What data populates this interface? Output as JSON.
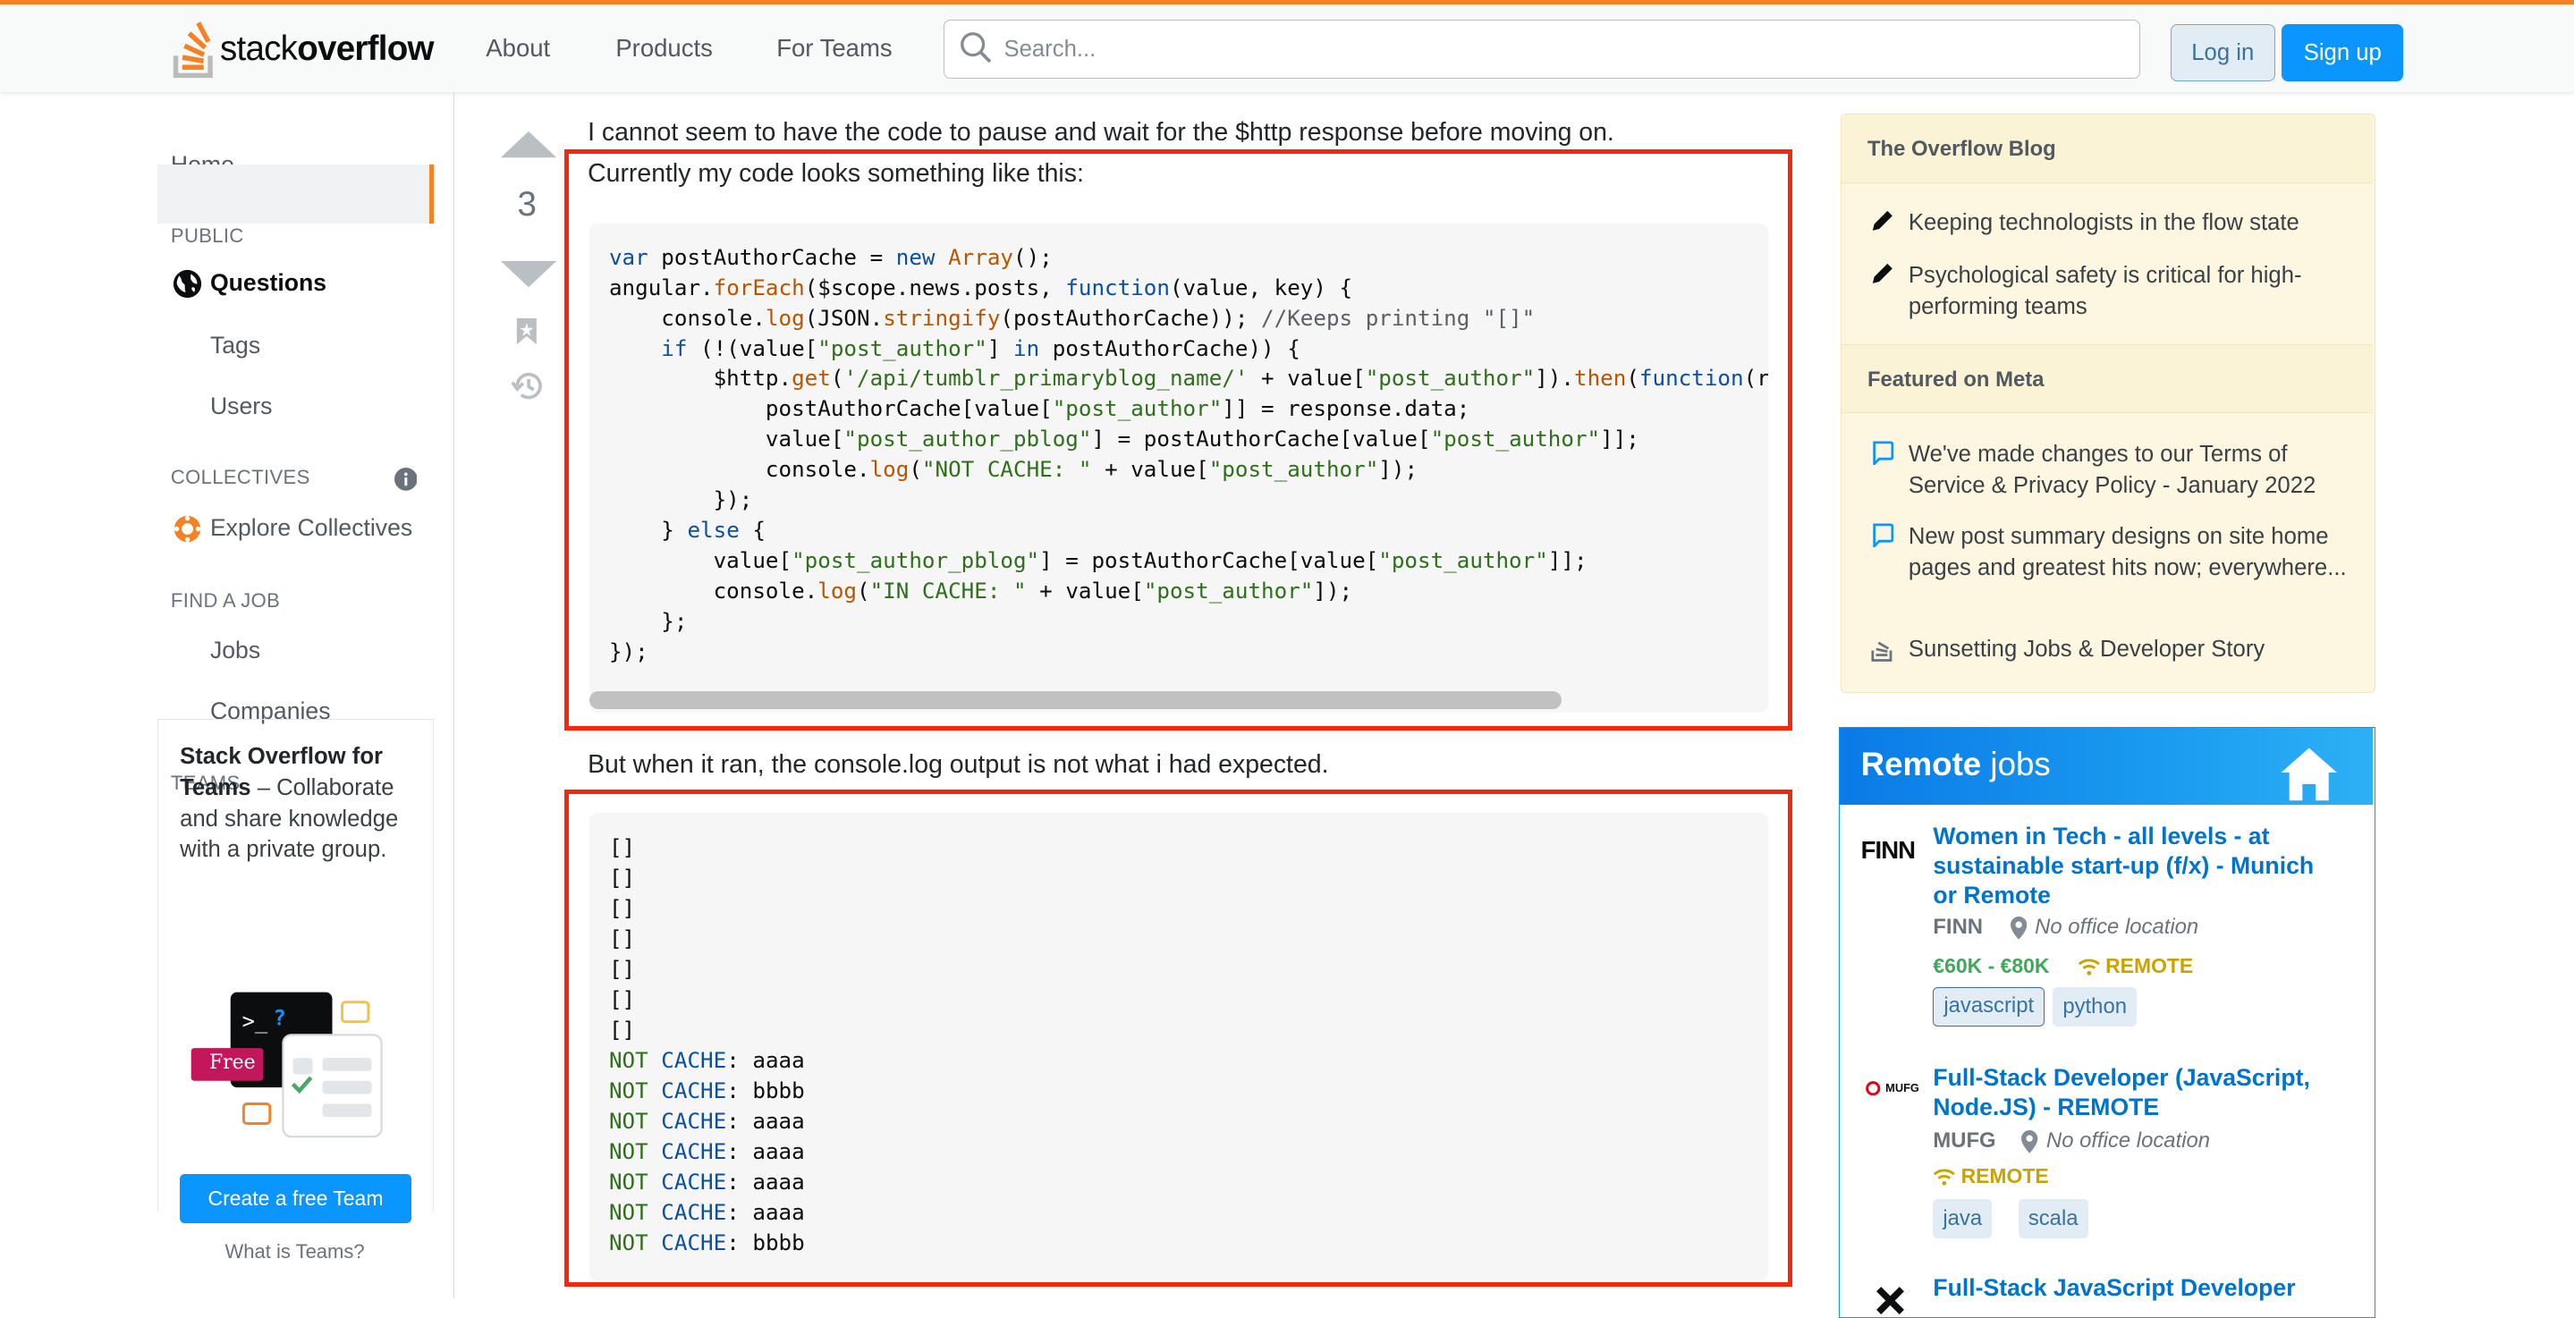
{
  "header": {
    "logo_regular": "stack",
    "logo_bold": "overflow",
    "nav": [
      "About",
      "Products",
      "For Teams"
    ],
    "search_placeholder": "Search...",
    "login": "Log in",
    "signup": "Sign up",
    "accent_color": "#f48225"
  },
  "sidebar": {
    "home": "Home",
    "public_heading": "PUBLIC",
    "questions": "Questions",
    "tags": "Tags",
    "users": "Users",
    "collectives_heading": "COLLECTIVES",
    "explore_collectives": "Explore Collectives",
    "find_job_heading": "FIND A JOB",
    "jobs": "Jobs",
    "companies": "Companies",
    "teams_heading": "TEAMS",
    "teams_card": {
      "title": "Stack Overflow for Teams",
      "body": "– Collaborate and share knowledge with a private group.",
      "badge": "Free",
      "create_button": "Create a free Team",
      "what_link": "What is Teams?"
    }
  },
  "question": {
    "vote_count": "3",
    "para1": "I cannot seem to have the code to pause and wait for the $http response before moving on.",
    "para2": "Currently my code looks something like this:",
    "para3": "But when it ran, the console.log output is not what i had expected.",
    "output_lines": [
      "[]",
      "[]",
      "[]",
      "[]",
      "[]",
      "[]",
      "[]"
    ],
    "cache_lines": [
      "aaaa",
      "bbbb",
      "aaaa",
      "aaaa",
      "aaaa",
      "aaaa",
      "bbbb"
    ],
    "cache_prefix_a": "NOT",
    "cache_prefix_b": "CACHE",
    "highlight_color": "#f7260c"
  },
  "blog": {
    "heading": "The Overflow Blog",
    "items": [
      "Keeping technologists in the flow state",
      "Psychological safety is critical for high-performing teams"
    ],
    "meta_heading": "Featured on Meta",
    "meta_items": [
      "We've made changes to our Terms of Service & Privacy Policy - January 2022",
      "New post summary designs on site home pages and greatest hits now; everywhere...",
      "Sunsetting Jobs & Developer Story"
    ]
  },
  "jobs": {
    "heading_bold": "Remote",
    "heading_regular": "jobs",
    "list": [
      {
        "logo": "FINN",
        "title": "Women in Tech - all levels - at sustainable start-up (f/x) - Munich or Remote",
        "company": "FINN",
        "location": "No office location",
        "salary": "€60K - €80K",
        "remote": "REMOTE",
        "tags": [
          "javascript",
          "python"
        ]
      },
      {
        "logo": "MUFG",
        "title": "Full-Stack Developer (JavaScript, Node.JS) - REMOTE",
        "company": "MUFG",
        "location": "No office location",
        "remote": "REMOTE",
        "tags": [
          "java",
          "scala"
        ]
      },
      {
        "title": "Full-Stack JavaScript Developer"
      }
    ]
  }
}
